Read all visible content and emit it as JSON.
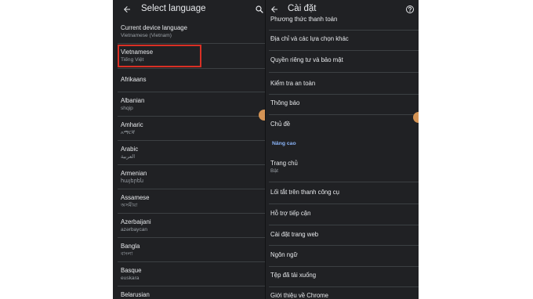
{
  "left": {
    "title": "Select language",
    "current": {
      "label": "Current device language",
      "value": "Vietnamese (Vietnam)"
    },
    "selected": {
      "name": "Vietnamese",
      "native": "Tiếng Việt"
    },
    "languages": [
      {
        "name": "Afrikaans",
        "native": ""
      },
      {
        "name": "Albanian",
        "native": "shqip"
      },
      {
        "name": "Amharic",
        "native": "አማርኛ"
      },
      {
        "name": "Arabic",
        "native": "العربية"
      },
      {
        "name": "Armenian",
        "native": "հայերեն"
      },
      {
        "name": "Assamese",
        "native": "অসমীয়া"
      },
      {
        "name": "Azerbaijani",
        "native": "azərbaycan"
      },
      {
        "name": "Bangla",
        "native": "বাংলা"
      },
      {
        "name": "Basque",
        "native": "euskara"
      },
      {
        "name": "Belarusian",
        "native": ""
      }
    ]
  },
  "right": {
    "title": "Cài đặt",
    "items": [
      {
        "label": "Phương thức thanh toán",
        "sub": ""
      },
      {
        "label": "Địa chỉ và các lựa chọn khác",
        "sub": ""
      },
      {
        "label": "Quyền riêng tư và bảo mật",
        "sub": ""
      },
      {
        "label": "Kiểm tra an toàn",
        "sub": ""
      },
      {
        "label": "Thông báo",
        "sub": ""
      },
      {
        "label": "Chủ đề",
        "sub": ""
      },
      {
        "label": "Trang chủ",
        "sub": "Bật"
      },
      {
        "label": "Lối tắt trên thanh công cụ",
        "sub": ""
      },
      {
        "label": "Hỗ trợ tiếp cận",
        "sub": ""
      },
      {
        "label": "Cài đặt trang web",
        "sub": ""
      },
      {
        "label": "Ngôn ngữ",
        "sub": ""
      },
      {
        "label": "Tệp đã tải xuống",
        "sub": ""
      },
      {
        "label": "Giới thiệu về Chrome",
        "sub": ""
      }
    ],
    "section_header": "Nâng cao"
  },
  "icons": {
    "back": "arrow-left-icon",
    "search": "search-icon",
    "help": "help-circle-icon"
  },
  "colors": {
    "background": "#202124",
    "text": "#e8eaed",
    "subtext": "#9aa0a6",
    "accent": "#8ab4f8",
    "highlight": "#d93025"
  }
}
